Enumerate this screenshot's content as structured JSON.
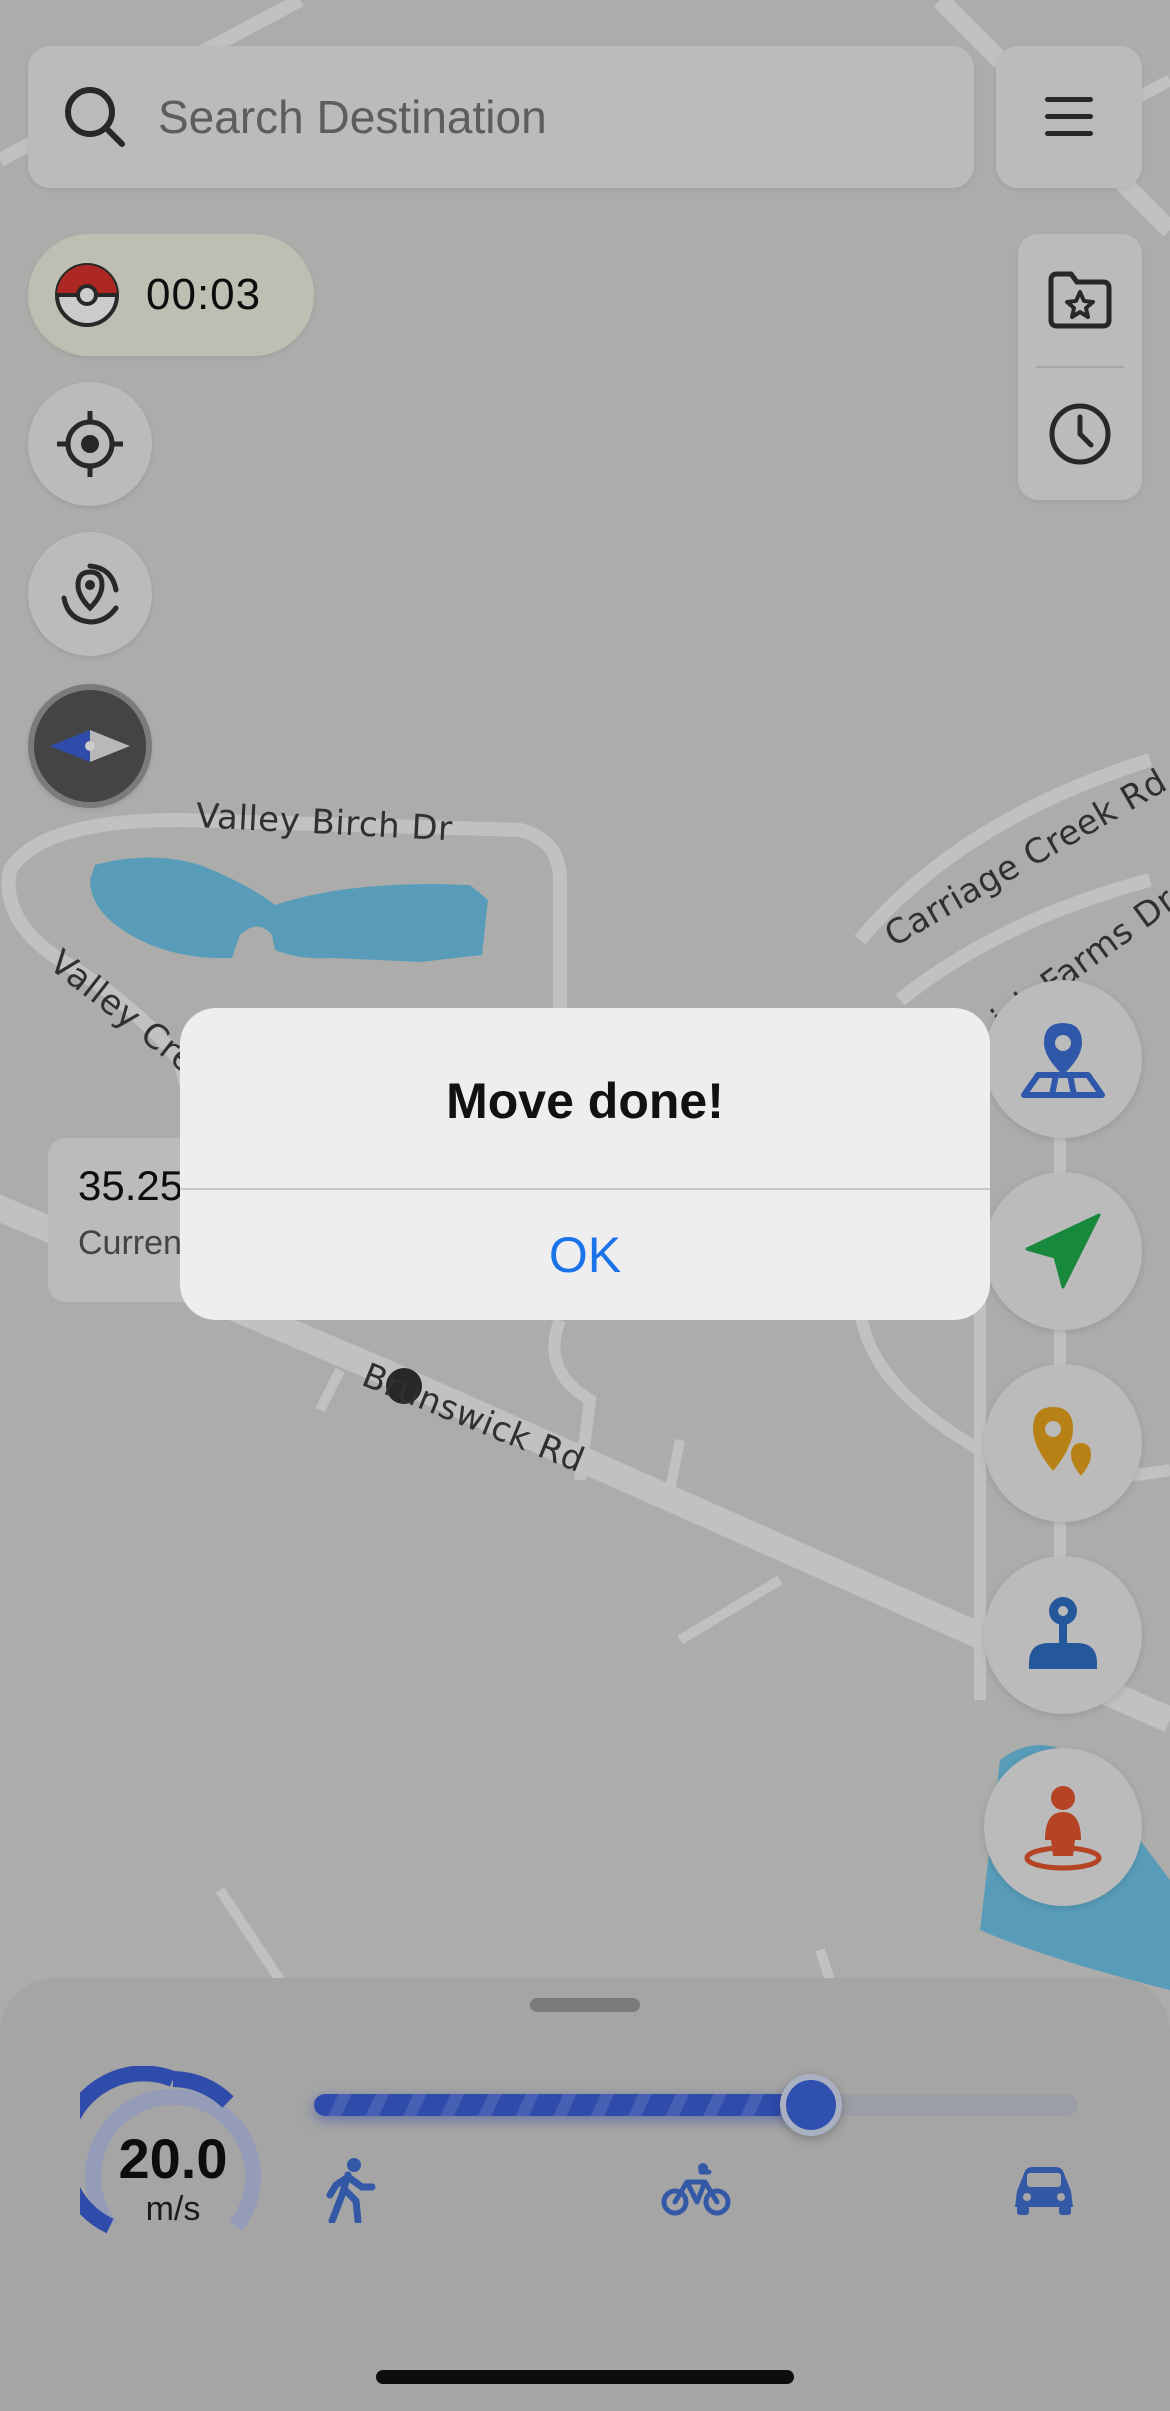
{
  "search": {
    "placeholder": "Search Destination"
  },
  "timer": {
    "value": "00:03"
  },
  "map": {
    "streets": {
      "valley_birch": "Valley Birch Dr",
      "valley_creek": "Valley Creek Dr",
      "carriage_creek": "Carriage Creek Rd",
      "farms": "ick Farms Dr",
      "brunswick": "Brunswick Rd"
    }
  },
  "info_card": {
    "value": "35.25",
    "label": "Curren"
  },
  "alert": {
    "title": "Move done!",
    "ok_label": "OK"
  },
  "speed": {
    "value": "20.0",
    "unit": "m/s",
    "slider_fraction": 0.65
  },
  "colors": {
    "accent_blue": "#3d64db",
    "link_blue": "#1a73e8",
    "water": "#6ec4e8",
    "orange": "#e2552e",
    "green": "#1faa4b",
    "gold": "#e6a21c"
  },
  "icons": {
    "search": "search-icon",
    "menu": "hamburger-menu-icon",
    "ball": "pokeball-icon",
    "favorites": "folder-star-icon",
    "history": "clock-icon",
    "locate": "crosshair-icon",
    "refresh": "rotate-pin-icon",
    "compass": "compass-icon",
    "teleport": "map-pin-icon",
    "navigate": "paper-plane-icon",
    "multi_spot": "multi-pin-icon",
    "joystick": "joystick-icon",
    "person": "person-pin-icon",
    "walk": "walk-icon",
    "bike": "bike-icon",
    "car": "car-icon"
  }
}
